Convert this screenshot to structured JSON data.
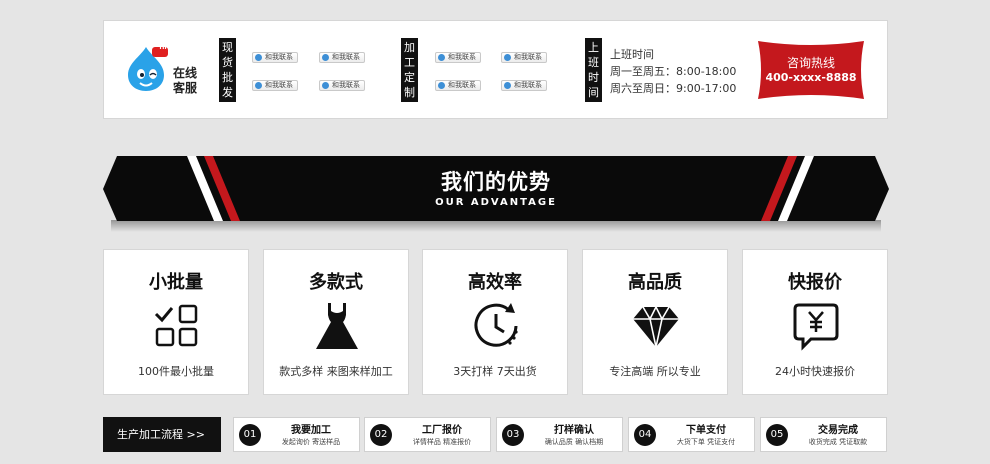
{
  "contact": {
    "online_label": "在线客服",
    "mascot_badge": "HI",
    "stock_label": "现货批发",
    "custom_label": "加工定制",
    "hours_label": "上班时间",
    "qq_buttons": [
      "和我联系",
      "和我联系",
      "和我联系",
      "和我联系",
      "和我联系",
      "和我联系",
      "和我联系",
      "和我联系"
    ],
    "hours": {
      "title": "上班时间",
      "weekday": "周一至周五：8:00-18:00",
      "weekend": "周六至周日：9:00-17:00"
    },
    "hotline": {
      "title": "咨询热线",
      "phone": "400-xxxx-8888",
      "color": "#c4181d"
    }
  },
  "banner": {
    "title": "我们的优势",
    "subtitle": "OUR ADVANTAGE"
  },
  "features": [
    {
      "title": "小批量",
      "desc": "100件最小批量",
      "icon": "grid-check-icon"
    },
    {
      "title": "多款式",
      "desc": "款式多样  来图来样加工",
      "icon": "dress-icon"
    },
    {
      "title": "高效率",
      "desc": "3天打样  7天出货",
      "icon": "clock-icon"
    },
    {
      "title": "高品质",
      "desc": "专注高端 所以专业",
      "icon": "diamond-icon"
    },
    {
      "title": "快报价",
      "desc": "24小时快速报价",
      "icon": "yen-chat-icon"
    }
  ],
  "process": {
    "label": "生产加工流程 >>",
    "steps": [
      {
        "num": "01",
        "title": "我要加工",
        "desc": "发起询价  寄送样品"
      },
      {
        "num": "02",
        "title": "工厂报价",
        "desc": "详情样品  精准报价"
      },
      {
        "num": "03",
        "title": "打样确认",
        "desc": "确认品质  确认档期"
      },
      {
        "num": "04",
        "title": "下单支付",
        "desc": "大货下单  凭证支付"
      },
      {
        "num": "05",
        "title": "交易完成",
        "desc": "收货完成  凭证取款"
      }
    ]
  }
}
